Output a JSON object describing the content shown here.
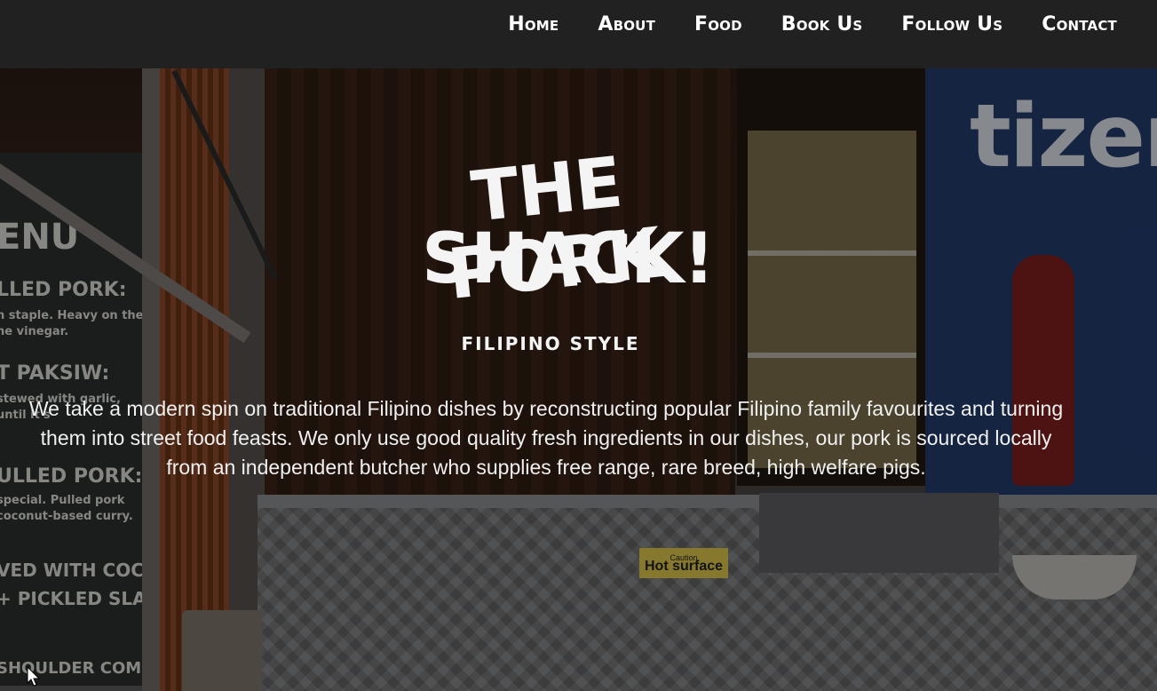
{
  "nav": {
    "items": [
      {
        "label": "Home"
      },
      {
        "label": "About"
      },
      {
        "label": "Food"
      },
      {
        "label": "Book Us"
      },
      {
        "label": "Follow Us"
      },
      {
        "label": "Contact"
      }
    ]
  },
  "hero": {
    "logo": {
      "line1": "THE PORK",
      "line2": "SHACK!",
      "tagline": "FILIPINO STYLE"
    },
    "description": "We take a modern spin on traditional Filipino dishes by reconstructing popular Filipino family favourites and turning them into street food feasts. We only use good quality fresh ingredients in our dishes, our pork is sourced locally from an independent butcher who supplies free range, rare breed, high welfare pigs."
  },
  "background_photo": {
    "chalkboard_lines": [
      "ENU",
      "LLED PORK:",
      "n staple. Heavy on the",
      "ne vinegar.",
      "T PAKSIW:",
      "stewed with garlic,",
      "until it's",
      "ULLED PORK:",
      "special. Pulled pork",
      "coconut-based curry.",
      "VED WITH COCONUT",
      "+ PICKLED SLAW",
      "SHOULDER COMES FROM"
    ],
    "sign_text": "tizer",
    "sticker_caution": "Caution",
    "sticker_text": "Hot surface"
  },
  "colors": {
    "navbar_bg": "#212121",
    "nav_text": "#ffffff",
    "overlay": "rgba(0,0,0,0.38)"
  }
}
